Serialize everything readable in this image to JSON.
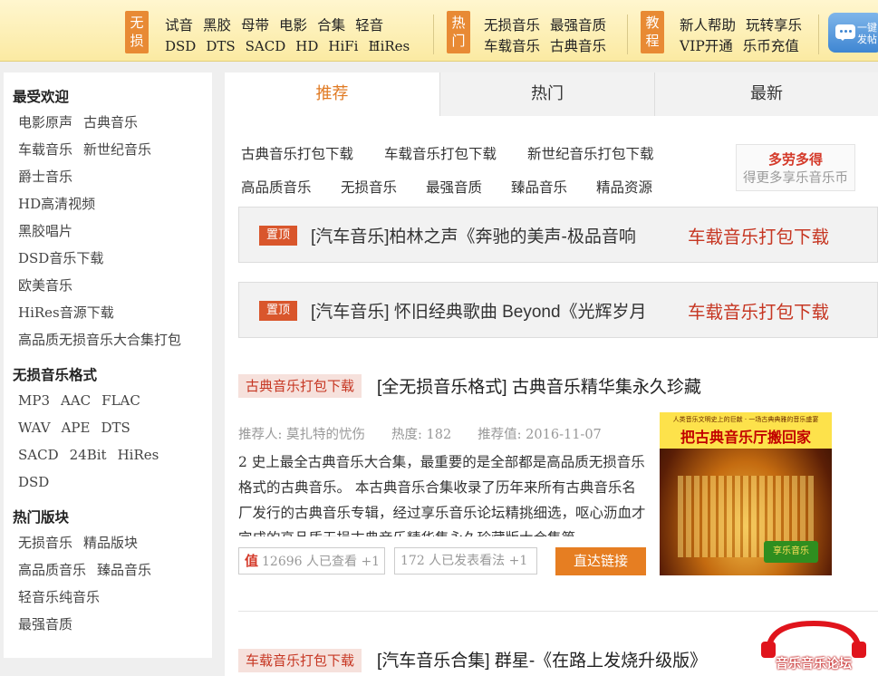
{
  "topnav": {
    "groups": [
      {
        "tag": "无损",
        "rows": [
          [
            "试音",
            "黑胶",
            "母带",
            "电影",
            "合集",
            "轻音"
          ],
          [
            "DSD",
            "DTS",
            "SACD",
            "HD",
            "HiFi",
            "HiRes"
          ]
        ]
      },
      {
        "tag": "热门",
        "rows": [
          [
            "无损音乐",
            "最强音质"
          ],
          [
            "车载音乐",
            "古典音乐"
          ]
        ]
      },
      {
        "tag": "教程",
        "rows": [
          [
            "新人帮助",
            "玩转享乐"
          ],
          [
            "VIP开通",
            "乐币充值"
          ]
        ]
      }
    ],
    "share_label": "一键发帖"
  },
  "sidebar": {
    "sections": [
      {
        "title": "最受欢迎",
        "rows": [
          [
            "电影原声",
            "古典音乐"
          ],
          [
            "车载音乐",
            "新世纪音乐"
          ],
          [
            "爵士音乐"
          ],
          [
            "HD高清视频"
          ],
          [
            "黑胶唱片"
          ],
          [
            "DSD音乐下载"
          ],
          [
            "欧美音乐"
          ],
          [
            "HiRes音源下载"
          ],
          [
            "高品质无损音乐大合集打包"
          ]
        ]
      },
      {
        "title": "无损音乐格式",
        "rows": [
          [
            "MP3",
            "AAC",
            "FLAC"
          ],
          [
            "WAV",
            "APE",
            "DTS"
          ],
          [
            "SACD",
            "24Bit",
            "HiRes"
          ],
          [
            "DSD"
          ]
        ]
      },
      {
        "title": "热门版块",
        "rows": [
          [
            "无损音乐",
            "精品版块"
          ],
          [
            "高品质音乐",
            "臻品音乐"
          ],
          [
            "轻音乐纯音乐"
          ],
          [
            "最强音质"
          ]
        ]
      }
    ]
  },
  "tabs": [
    "推荐",
    "热门",
    "最新"
  ],
  "quick_links": {
    "row1": [
      "古典音乐打包下载",
      "车载音乐打包下载",
      "新世纪音乐打包下载"
    ],
    "row2": [
      "高品质音乐",
      "无损音乐",
      "最强音质",
      "臻品音乐",
      "精品资源"
    ]
  },
  "bonus": {
    "title": "多劳多得",
    "subtitle": "得更多享乐音乐币"
  },
  "pinned": [
    {
      "label": "置顶",
      "title": "[汽车音乐]柏林之声《奔驰的美声-极品音响",
      "right": "车载音乐打包下载"
    },
    {
      "label": "置顶",
      "title": "[汽车音乐] 怀旧经典歌曲 Beyond《光辉岁月",
      "right": "车载音乐打包下载"
    }
  ],
  "post": {
    "category": "古典音乐打包下载",
    "title": "[全无损音乐格式] 古典音乐精华集永久珍藏",
    "recommender": "推荐人: 莫扎特的忧伤",
    "heat": "热度: 182",
    "rec_date": "推荐值: 2016-11-07",
    "excerpt": "2 史上最全古典音乐大合集，最重要的是全部都是高品质无损音乐格式的古典音乐。 本古典音乐合集收录了历年来所有古典音乐名厂发行的古典音乐专辑，经过享乐音乐论坛精挑细选，呕心沥血才完成的高品质无损古典音乐精华集永久珍藏版大合集第一",
    "vote_prefix": "值",
    "views": "12696 人已查看 +1",
    "comments": "172 人已发表看法 +1",
    "direct_link": "直达链接",
    "cover_banner": "人类音乐文明史上的巨献 · 一场古典典雅的音乐盛宴",
    "cover_title": "把古典音乐厅搬回家",
    "cover_stamp": "享乐音乐"
  },
  "post2": {
    "category": "车载音乐打包下载",
    "title": "[汽车音乐合集] 群星-《在路上发烧升级版》"
  },
  "footer_logo": "音乐音乐论坛",
  "colors": {
    "accent": "#e07a23",
    "red": "#c63622",
    "tag_orange": "#e88a34"
  }
}
